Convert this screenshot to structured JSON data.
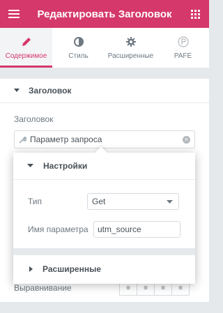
{
  "header": {
    "title": "Редактировать Заголовок",
    "menu_icon": "hamburger-icon",
    "grid_icon": "grid-icon",
    "color": "#d5386a"
  },
  "tabs": [
    {
      "label": "Содержимое",
      "icon": "pencil-icon",
      "active": true
    },
    {
      "label": "Стиль",
      "icon": "half-circle-icon",
      "active": false
    },
    {
      "label": "Расширенные",
      "icon": "gear-icon",
      "active": false
    },
    {
      "label": "PAFE",
      "icon": "pafe-logo-icon",
      "active": false
    }
  ],
  "section": {
    "title": "Заголовок"
  },
  "field": {
    "label": "Заголовок",
    "dynamic_value": "Параметр запроса"
  },
  "popup": {
    "settings_title": "Настройки",
    "type_label": "Тип",
    "type_value": "Get",
    "param_label": "Имя параметра",
    "param_value": "utm_source",
    "advanced_title": "Расширенные"
  },
  "background_row": {
    "label": "Выравнивание"
  }
}
